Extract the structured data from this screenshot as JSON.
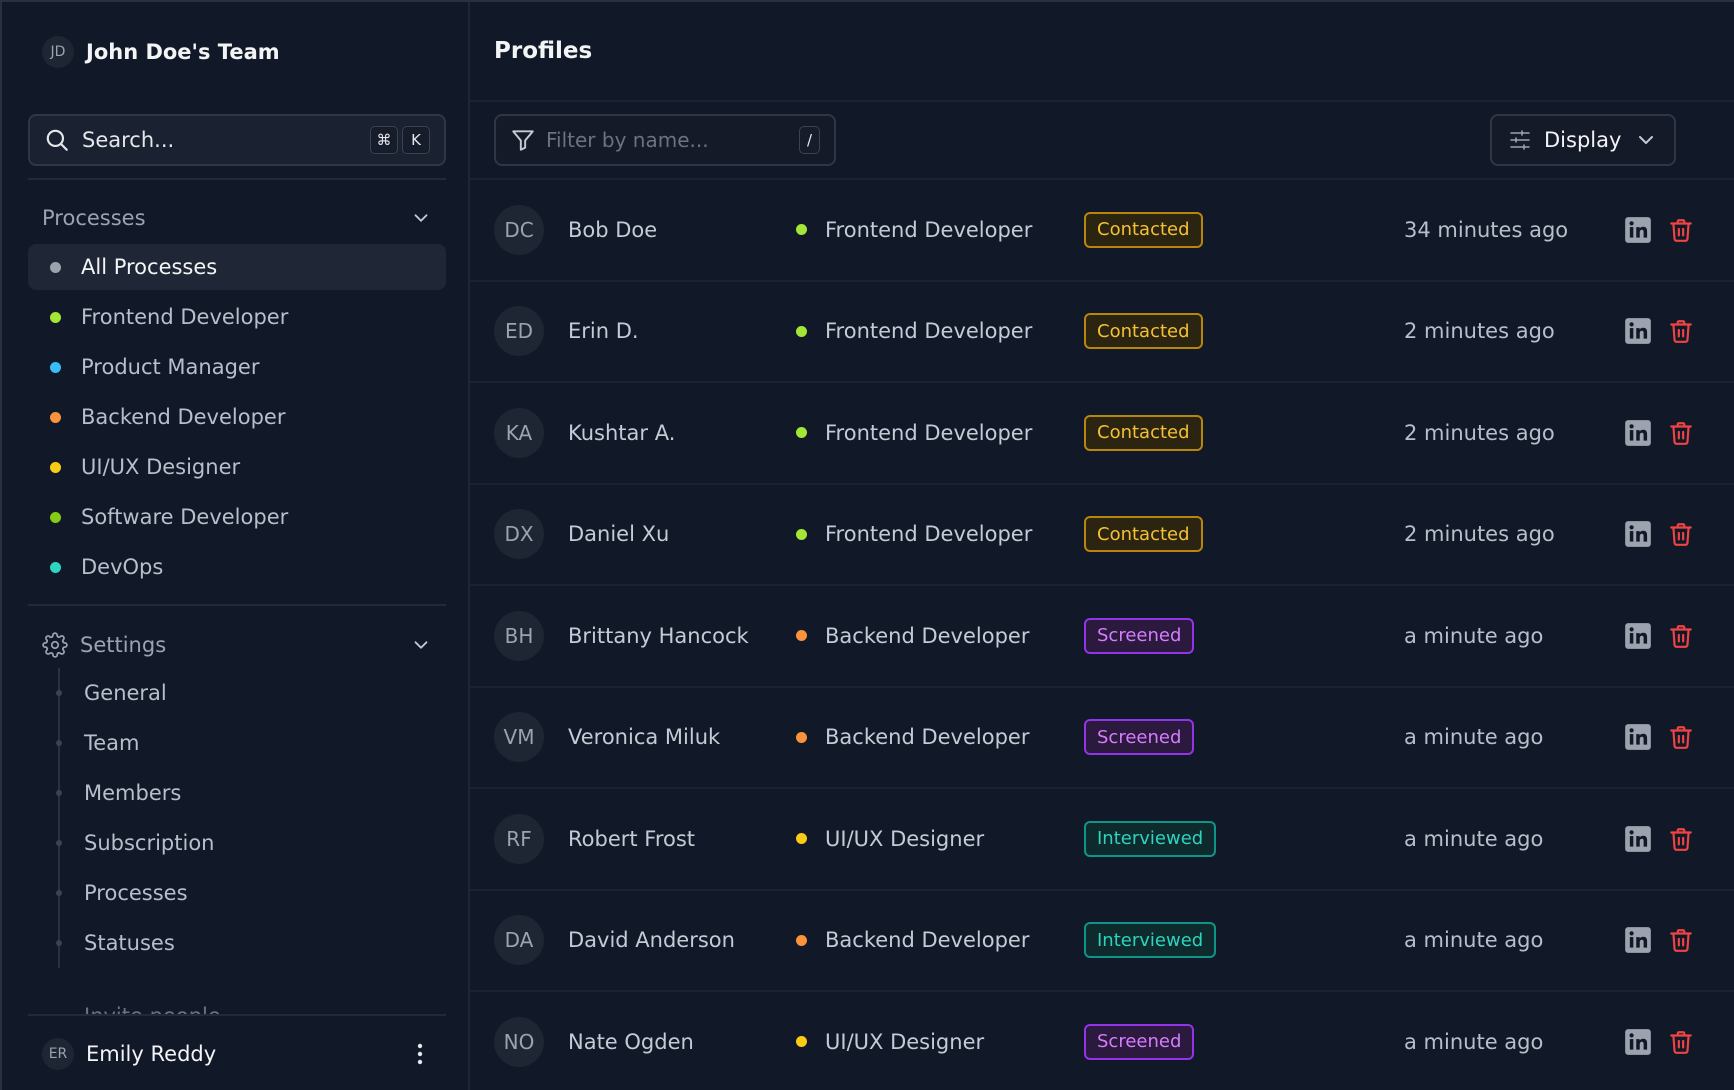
{
  "sidebar": {
    "team": {
      "initials": "JD",
      "name": "John Doe's Team"
    },
    "search": {
      "label": "Search...",
      "shortcut_keys": [
        "⌘",
        "K"
      ]
    },
    "processes_section": {
      "label": "Processes",
      "items": [
        {
          "label": "All Processes",
          "color": "#9ca3af",
          "active": true
        },
        {
          "label": "Frontend Developer",
          "color": "#a3e635"
        },
        {
          "label": "Product Manager",
          "color": "#38bdf8"
        },
        {
          "label": "Backend Developer",
          "color": "#fb923c"
        },
        {
          "label": "UI/UX Designer",
          "color": "#facc15"
        },
        {
          "label": "Software Developer",
          "color": "#84cc16"
        },
        {
          "label": "DevOps",
          "color": "#2dd4bf"
        }
      ]
    },
    "settings_section": {
      "label": "Settings",
      "items": [
        "General",
        "Team",
        "Members",
        "Subscription",
        "Processes",
        "Statuses"
      ],
      "partial_item": "Invite people"
    },
    "user": {
      "initials": "ER",
      "name": "Emily Reddy"
    }
  },
  "main": {
    "title": "Profiles",
    "filter": {
      "placeholder": "Filter by name...",
      "shortcut": "/"
    },
    "display_button": "Display",
    "profiles": [
      {
        "initials": "DC",
        "name": "Bob Doe",
        "process": "Frontend Developer",
        "process_color": "#a3e635",
        "status": "Contacted",
        "status_type": "contacted",
        "time": "34 minutes ago"
      },
      {
        "initials": "ED",
        "name": "Erin D.",
        "process": "Frontend Developer",
        "process_color": "#a3e635",
        "status": "Contacted",
        "status_type": "contacted",
        "time": "2 minutes ago"
      },
      {
        "initials": "KA",
        "name": "Kushtar A.",
        "process": "Frontend Developer",
        "process_color": "#a3e635",
        "status": "Contacted",
        "status_type": "contacted",
        "time": "2 minutes ago"
      },
      {
        "initials": "DX",
        "name": "Daniel Xu",
        "process": "Frontend Developer",
        "process_color": "#a3e635",
        "status": "Contacted",
        "status_type": "contacted",
        "time": "2 minutes ago"
      },
      {
        "initials": "BH",
        "name": "Brittany Hancock",
        "process": "Backend Developer",
        "process_color": "#fb923c",
        "status": "Screened",
        "status_type": "screened",
        "time": "a minute ago"
      },
      {
        "initials": "VM",
        "name": "Veronica Miluk",
        "process": "Backend Developer",
        "process_color": "#fb923c",
        "status": "Screened",
        "status_type": "screened",
        "time": "a minute ago"
      },
      {
        "initials": "RF",
        "name": "Robert Frost",
        "process": "UI/UX Designer",
        "process_color": "#facc15",
        "status": "Interviewed",
        "status_type": "interviewed",
        "time": "a minute ago"
      },
      {
        "initials": "DA",
        "name": "David Anderson",
        "process": "Backend Developer",
        "process_color": "#fb923c",
        "status": "Interviewed",
        "status_type": "interviewed",
        "time": "a minute ago"
      },
      {
        "initials": "NO",
        "name": "Nate Ogden",
        "process": "UI/UX Designer",
        "process_color": "#facc15",
        "status": "Screened",
        "status_type": "screened",
        "time": "a minute ago"
      }
    ],
    "row_icons": {
      "linkedin": "linkedin-icon",
      "delete": "trash-icon",
      "linkedin_color": "#9ca3af",
      "delete_color": "#ef4444"
    }
  }
}
